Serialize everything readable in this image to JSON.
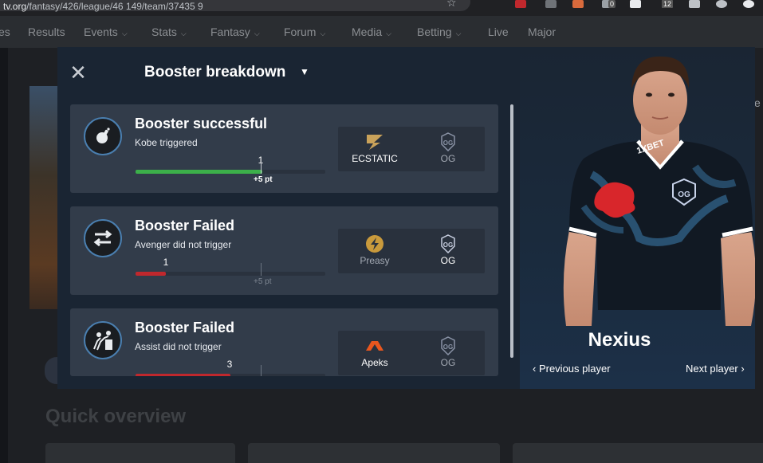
{
  "browser": {
    "url_prefix": "tv.org",
    "url_rest": "/fantasy/426/league/46 149/team/37435 9",
    "extension_badges": [
      "0",
      "12"
    ]
  },
  "nav": {
    "items": [
      {
        "label": "es",
        "has_dropdown": false
      },
      {
        "label": "Results",
        "has_dropdown": false
      },
      {
        "label": "Events",
        "has_dropdown": true
      },
      {
        "label": "Stats",
        "has_dropdown": true
      },
      {
        "label": "Fantasy",
        "has_dropdown": true
      },
      {
        "label": "Forum",
        "has_dropdown": true
      },
      {
        "label": "Media",
        "has_dropdown": true
      },
      {
        "label": "Betting",
        "has_dropdown": true
      },
      {
        "label": "Live",
        "has_dropdown": false
      },
      {
        "label": "Major",
        "has_dropdown": false
      }
    ]
  },
  "background": {
    "quick_overview_title": "Quick overview",
    "right_edge_text": "e"
  },
  "modal": {
    "close_icon": "close-icon",
    "title": "Booster breakdown",
    "boosters": [
      {
        "icon": "bomb-icon",
        "title": "Booster successful",
        "subtitle": "Kobe triggered",
        "progress_value": "1",
        "progress_fraction": 0.67,
        "target_label": "+5 pt",
        "status_color": "#3cb04a",
        "target_bold": true,
        "team1": {
          "name": "ECSTATIC",
          "logo": "ecstatic-logo",
          "highlighted": true
        },
        "team2": {
          "name": "OG",
          "logo": "og-logo",
          "highlighted": false
        }
      },
      {
        "icon": "swap-arrows-icon",
        "title": "Booster Failed",
        "subtitle": "Avenger did not trigger",
        "progress_value": "1",
        "progress_fraction": 0.16,
        "target_label": "+5 pt",
        "status_color": "#c0282d",
        "target_bold": false,
        "team1": {
          "name": "Preasy",
          "logo": "preasy-logo",
          "highlighted": false
        },
        "team2": {
          "name": "OG",
          "logo": "og-logo",
          "highlighted": true
        }
      },
      {
        "icon": "assist-icon",
        "title": "Booster Failed",
        "subtitle": "Assist did not trigger",
        "progress_value": "3",
        "progress_fraction": 0.5,
        "target_label": "+5 pt",
        "status_color": "#c0282d",
        "target_bold": false,
        "team1": {
          "name": "Apeks",
          "logo": "apeks-logo",
          "highlighted": true
        },
        "team2": {
          "name": "OG",
          "logo": "og-logo",
          "highlighted": false
        }
      }
    ],
    "player": {
      "name": "Nexius",
      "jersey_sponsor": "1XBET",
      "team_badge": "OG",
      "prev_label": "Previous player",
      "next_label": "Next player"
    }
  },
  "colors": {
    "modal_bg": "#1a2533",
    "card_bg": "#323c4a",
    "success": "#3cb04a",
    "failed": "#c0282d"
  }
}
